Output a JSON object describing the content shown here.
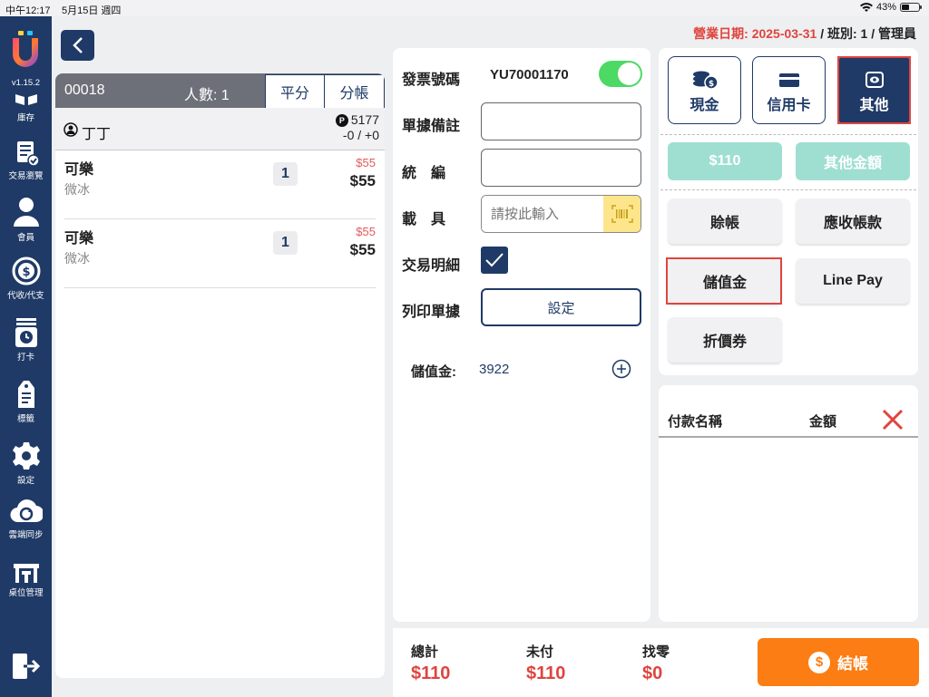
{
  "status_bar": {
    "time": "中午12:17",
    "date": "5月15日 週四",
    "battery": "43%"
  },
  "sidebar": {
    "version": "v1.15.2",
    "items": [
      {
        "label": "庫存",
        "icon": "inventory-icon"
      },
      {
        "label": "交易瀏覽",
        "icon": "transaction-browse-icon"
      },
      {
        "label": "會員",
        "icon": "member-icon"
      },
      {
        "label": "代收/代支",
        "icon": "collect-pay-icon"
      },
      {
        "label": "打卡",
        "icon": "clock-in-icon"
      },
      {
        "label": "標籤",
        "icon": "label-icon"
      },
      {
        "label": "設定",
        "icon": "settings-gear-icon"
      },
      {
        "label": "雲端同步",
        "icon": "cloud-sync-icon"
      },
      {
        "label": "桌位管理",
        "icon": "table-management-icon"
      }
    ]
  },
  "header": {
    "business_date_label": "營業日期: 2025-03-31",
    "shift_info": " / 班別: 1 / 管理員"
  },
  "order": {
    "number": "00018",
    "people": "人數: 1",
    "tabs": [
      "平分",
      "分帳"
    ],
    "customer": "丁丁",
    "points": "5177",
    "points_change": "-0 / +0",
    "items": [
      {
        "name": "可樂",
        "note": "微冰",
        "qty": "1",
        "orig_price": "$55",
        "price": "$55"
      },
      {
        "name": "可樂",
        "note": "微冰",
        "qty": "1",
        "orig_price": "$55",
        "price": "$55"
      }
    ]
  },
  "invoice": {
    "invoice_no_label": "發票號碼",
    "invoice_no": "YU70001170",
    "invoice_toggle_on": true,
    "note_label": "單據備註",
    "tax_id_label": "統　編",
    "carrier_label": "載　具",
    "carrier_placeholder": "請按此輸入",
    "detail_label": "交易明細",
    "detail_checked": true,
    "print_label": "列印單據",
    "setting_button": "設定",
    "stored_value_label": "儲值金:",
    "stored_value": "3922"
  },
  "payment": {
    "types": [
      {
        "label": "現金",
        "icon": "cash-coins-icon"
      },
      {
        "label": "信用卡",
        "icon": "credit-card-icon"
      },
      {
        "label": "其他",
        "icon": "other-payment-icon"
      }
    ],
    "active_type": "其他",
    "quick_amount": "$110",
    "other_amount": "其他金額",
    "options": [
      "賒帳",
      "應收帳款",
      "儲值金",
      "Line Pay",
      "折價券"
    ],
    "highlighted": [
      "其他",
      "儲值金"
    ],
    "list_header_name": "付款名稱",
    "list_header_amount": "金額"
  },
  "footer": {
    "total_label": "總計",
    "total": "$110",
    "unpaid_label": "未付",
    "unpaid": "$110",
    "change_label": "找零",
    "change": "$0",
    "checkout_label": "結帳",
    "checkout_icon_glyph": "$"
  },
  "colors": {
    "navy": "#1f3a66",
    "accent_red": "#e0443e",
    "checkout_orange": "#fb7d13",
    "teal_amount": "#9edfd1",
    "toggle_green": "#4cd964"
  }
}
